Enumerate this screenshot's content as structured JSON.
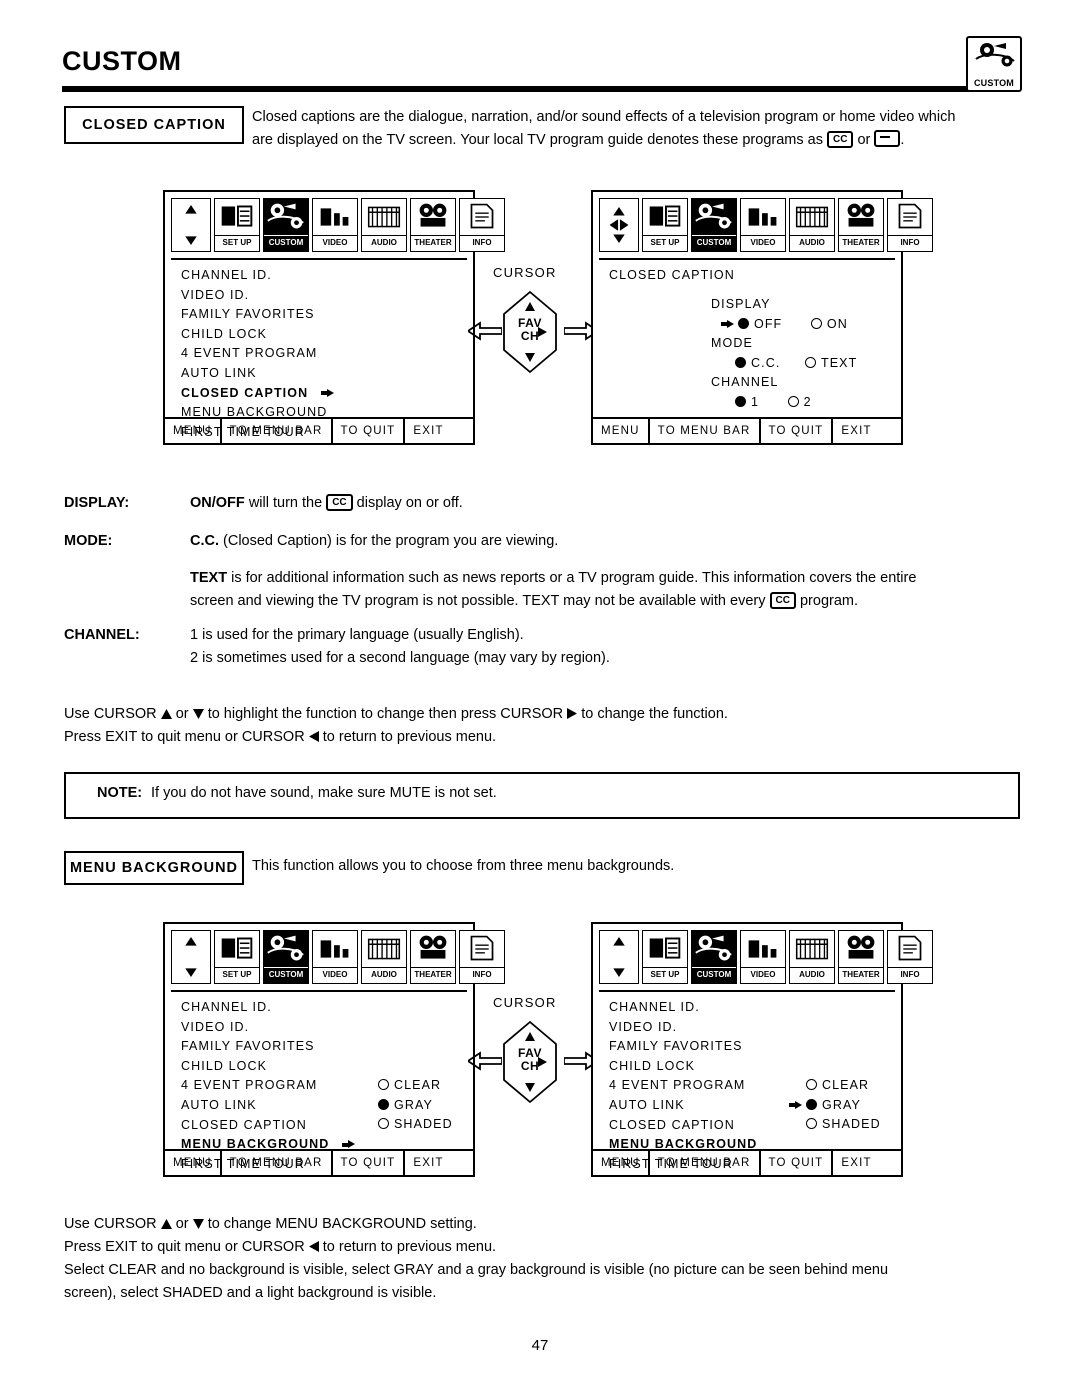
{
  "header": {
    "title": "CUSTOM",
    "badge_label": "CUSTOM"
  },
  "closed_caption_section": {
    "label": "CLOSED CAPTION",
    "intro_line1": "Closed captions are the dialogue, narration, and/or sound effects of a television program or home video which",
    "intro_line2a": "are displayed on the TV screen.  Your local TV program guide denotes these programs as",
    "intro_cc": "CC",
    "intro_or": "or",
    "intro_period": ".",
    "cursor_label": "CURSOR",
    "favch_line1": "FAV",
    "favch_line2": "CH",
    "menu_left": {
      "icons": [
        {
          "name": "arrows",
          "caption": ""
        },
        {
          "name": "set-up",
          "caption": "SET UP"
        },
        {
          "name": "custom",
          "caption": "CUSTOM"
        },
        {
          "name": "video",
          "caption": "VIDEO"
        },
        {
          "name": "audio",
          "caption": "AUDIO"
        },
        {
          "name": "theater",
          "caption": "THEATER"
        },
        {
          "name": "info",
          "caption": "INFO"
        }
      ],
      "items": [
        "CHANNEL ID.",
        "VIDEO ID.",
        "FAMILY FAVORITES",
        "CHILD LOCK",
        "4 EVENT PROGRAM",
        "AUTO LINK",
        "CLOSED CAPTION",
        "MENU BACKGROUND",
        "FIRST TIME TOUR"
      ],
      "highlight_index": 6,
      "bottom_bar": [
        "MENU",
        "TO MENU BAR",
        "TO QUIT",
        "EXIT"
      ]
    },
    "menu_right": {
      "title": "CLOSED CAPTION",
      "groups": [
        {
          "label": "DISPLAY",
          "options": [
            {
              "label": "OFF",
              "selected": true,
              "arrow": true
            },
            {
              "label": "ON",
              "selected": false,
              "arrow": false
            }
          ]
        },
        {
          "label": "MODE",
          "options": [
            {
              "label": "C.C.",
              "selected": true,
              "arrow": false
            },
            {
              "label": "TEXT",
              "selected": false,
              "arrow": false
            }
          ]
        },
        {
          "label": "CHANNEL",
          "options": [
            {
              "label": "1",
              "selected": true,
              "arrow": false
            },
            {
              "label": "2",
              "selected": false,
              "arrow": false
            }
          ]
        }
      ],
      "bottom_bar": [
        "MENU",
        "TO MENU BAR",
        "TO QUIT",
        "EXIT"
      ]
    },
    "definitions": [
      {
        "term": "DISPLAY:",
        "pre": "ON/OFF",
        "post": "will turn the",
        "cc": "CC",
        "post2": "display on or off."
      },
      {
        "term": "MODE:",
        "bold_lead": "C.C.",
        "text": "(Closed Caption) is for the program you are viewing."
      }
    ],
    "text_para": {
      "lead": "TEXT",
      "line1": "is for additional information such as news reports or a TV program guide.  This information covers the entire",
      "line2a": "screen and viewing the TV program is not possible.  TEXT may not be available with every",
      "cc": "CC",
      "line2b": "program."
    },
    "channel_def": {
      "term": "CHANNEL:",
      "line1": "1 is used for the primary language (usually English).",
      "line2": "2 is sometimes used for a second language (may vary by region)."
    },
    "usage_line1a": "Use CURSOR",
    "usage_line1b": "or",
    "usage_line1c": "to highlight the function to change then press CURSOR",
    "usage_line1d": "to change the function.",
    "usage_line2a": "Press EXIT to quit menu or CURSOR",
    "usage_line2b": "to return to previous menu."
  },
  "note": {
    "label": "NOTE:",
    "text": "If you do not have sound, make sure MUTE is not set."
  },
  "menu_background_section": {
    "label": "MENU BACKGROUND",
    "intro": "This function allows you to choose from three menu backgrounds.",
    "cursor_label": "CURSOR",
    "favch_line1": "FAV",
    "favch_line2": "CH",
    "menu_left": {
      "items": [
        "CHANNEL ID.",
        "VIDEO ID.",
        "FAMILY FAVORITES",
        "CHILD LOCK",
        "4 EVENT PROGRAM",
        "AUTO LINK",
        "CLOSED CAPTION",
        "MENU BACKGROUND",
        "FIRST TIME TOUR"
      ],
      "highlight_index": 7,
      "options": [
        {
          "label": "CLEAR",
          "selected": false
        },
        {
          "label": "GRAY",
          "selected": true
        },
        {
          "label": "SHADED",
          "selected": false
        }
      ],
      "bottom_bar": [
        "MENU",
        "TO MENU BAR",
        "TO QUIT",
        "EXIT"
      ]
    },
    "menu_right": {
      "items": [
        "CHANNEL ID.",
        "VIDEO ID.",
        "FAMILY FAVORITES",
        "CHILD LOCK",
        "4 EVENT PROGRAM",
        "AUTO LINK",
        "CLOSED CAPTION",
        "MENU BACKGROUND",
        "FIRST TIME TOUR"
      ],
      "highlight_index": 7,
      "options": [
        {
          "label": "CLEAR",
          "selected": false
        },
        {
          "label": "GRAY",
          "selected": true,
          "arrow": true
        },
        {
          "label": "SHADED",
          "selected": false
        }
      ],
      "bottom_bar": [
        "MENU",
        "TO MENU BAR",
        "TO QUIT",
        "EXIT"
      ]
    },
    "usage_line1a": "Use CURSOR",
    "usage_line1b": "or",
    "usage_line1c": "to change MENU BACKGROUND setting.",
    "usage_line2a": "Press EXIT to quit menu or CURSOR",
    "usage_line2b": "to return to previous menu.",
    "usage_line3": "Select CLEAR and no background is visible, select GRAY and a gray background is visible (no picture can be seen behind menu",
    "usage_line4": "screen), select SHADED and a light background is visible."
  },
  "footer": {
    "page_number": "47"
  }
}
